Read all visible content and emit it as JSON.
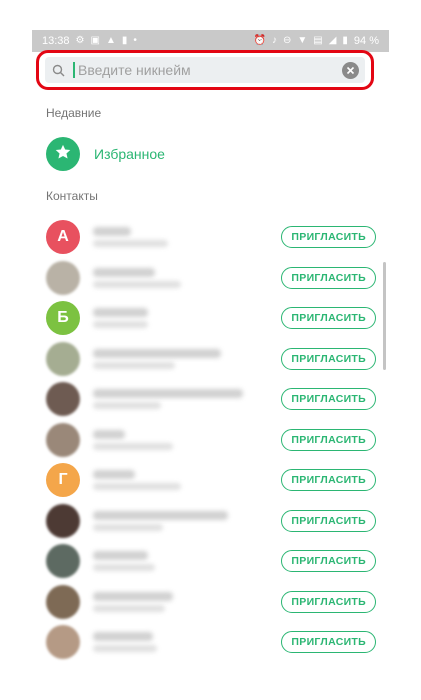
{
  "status_bar": {
    "time": "13:38",
    "battery": "94 %",
    "left_icons": [
      "sync-icon",
      "folder-icon",
      "warning-icon",
      "phone-icon",
      "dot-icon"
    ],
    "right_icons": [
      "alarm-icon",
      "mute-icon",
      "dnd-icon",
      "wifi-icon",
      "no-sim-icon",
      "signal-icon",
      "battery-icon"
    ]
  },
  "search": {
    "placeholder": "Введите никнейм",
    "value": "",
    "highlight_color": "#e30613"
  },
  "sections": {
    "recent_title": "Недавние",
    "contacts_title": "Контакты"
  },
  "favorites": {
    "label": "Избранное",
    "icon": "star-icon"
  },
  "invite_label": "ПРИГЛАСИТЬ",
  "accent_color": "#2bb673",
  "contacts": [
    {
      "avatar_letter": "А",
      "avatar_color": "#e8515f"
    },
    {
      "avatar_letter": "",
      "avatar_color": "#b9b2a6"
    },
    {
      "avatar_letter": "Б",
      "avatar_color": "#7cc241"
    },
    {
      "avatar_letter": "",
      "avatar_color": "#a5ad92"
    },
    {
      "avatar_letter": "",
      "avatar_color": "#6e5b52"
    },
    {
      "avatar_letter": "",
      "avatar_color": "#9a8879"
    },
    {
      "avatar_letter": "Г",
      "avatar_color": "#f4a64a"
    },
    {
      "avatar_letter": "",
      "avatar_color": "#4d3a34"
    },
    {
      "avatar_letter": "",
      "avatar_color": "#5d6a62"
    },
    {
      "avatar_letter": "",
      "avatar_color": "#7e6a55"
    },
    {
      "avatar_letter": "",
      "avatar_color": "#b59a85"
    }
  ]
}
